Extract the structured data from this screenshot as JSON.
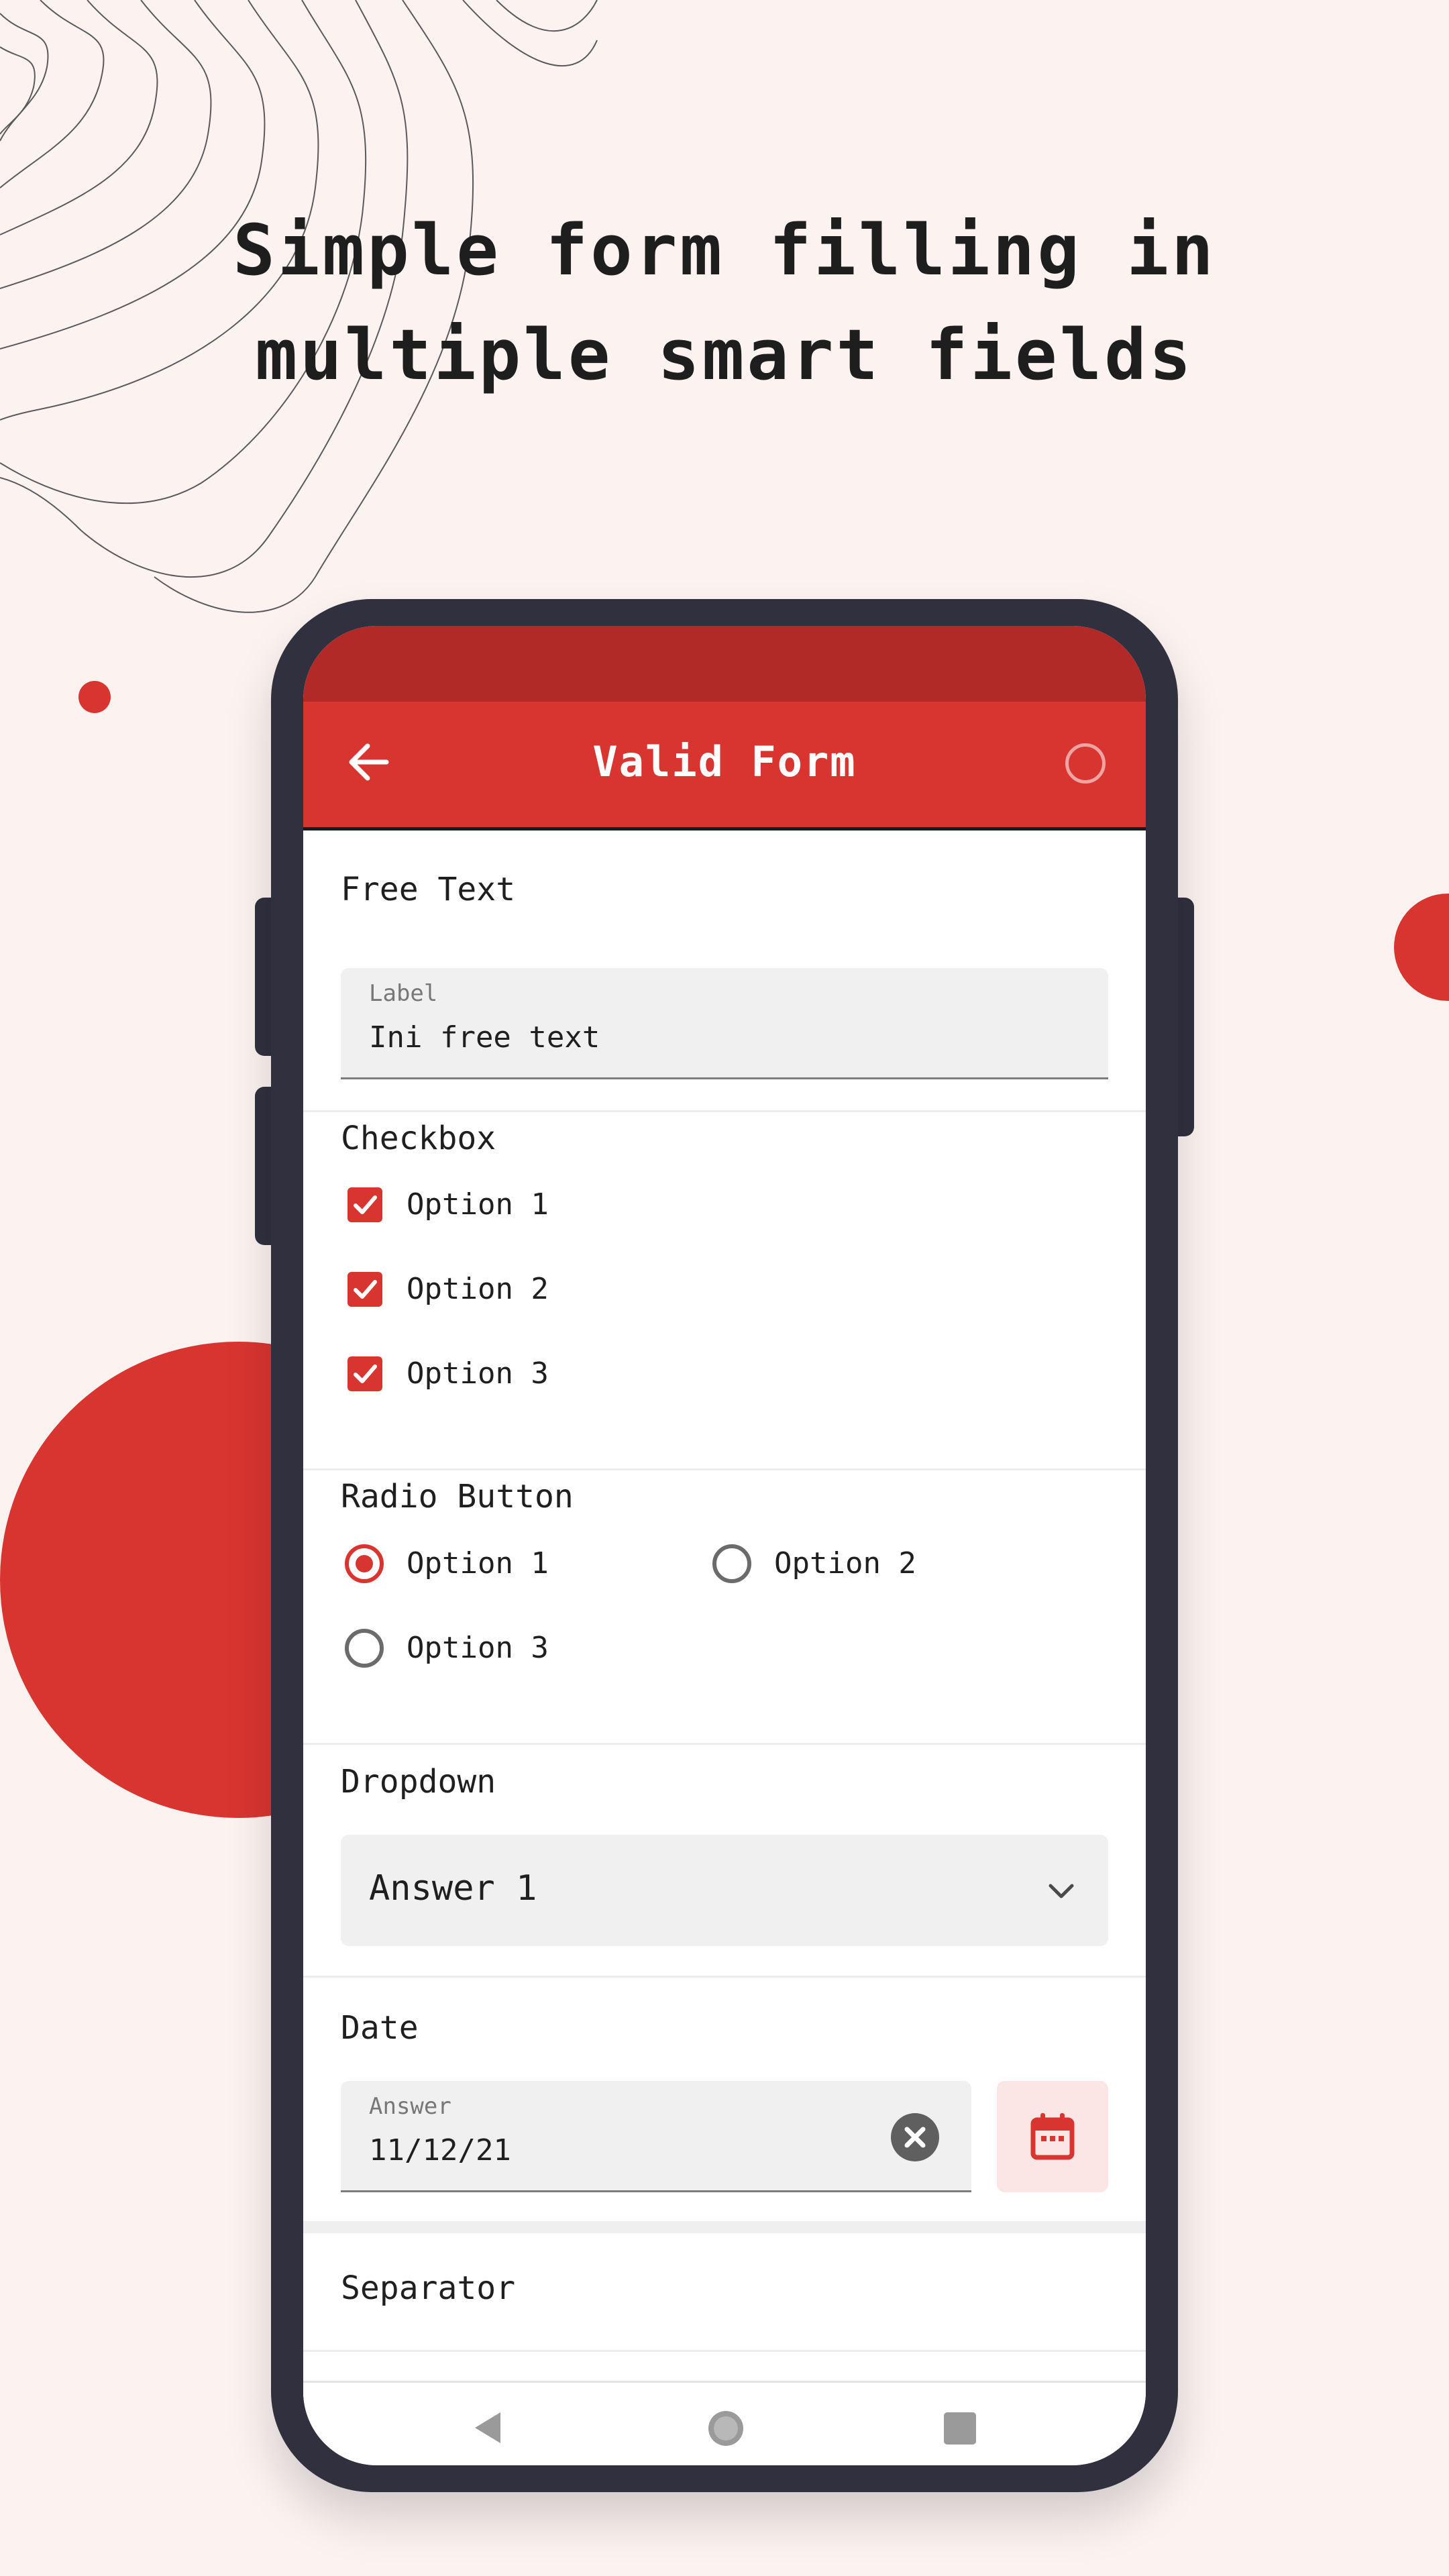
{
  "headline": {
    "line1": "Simple form filling in",
    "line2": "multiple smart fields"
  },
  "colors": {
    "accent": "#d93530",
    "status_bar": "#b12a28",
    "background": "#fcf3f1",
    "device": "#30303f"
  },
  "app_bar": {
    "title": "Valid Form",
    "back_icon": "arrow-left-icon",
    "action_icon": "circle-outline-icon"
  },
  "free_text": {
    "title": "Free Text",
    "label": "Label",
    "value": "Ini free text"
  },
  "checkbox": {
    "title": "Checkbox",
    "options": [
      {
        "label": "Option 1",
        "checked": true
      },
      {
        "label": "Option 2",
        "checked": true
      },
      {
        "label": "Option 3",
        "checked": true
      }
    ]
  },
  "radio": {
    "title": "Radio Button",
    "options": [
      {
        "label": "Option 1",
        "selected": true
      },
      {
        "label": "Option 2",
        "selected": false
      },
      {
        "label": "Option 3",
        "selected": false
      }
    ]
  },
  "dropdown": {
    "title": "Dropdown",
    "value": "Answer 1",
    "icon": "chevron-down-icon"
  },
  "date": {
    "title": "Date",
    "label": "Answer",
    "value": "11/12/21",
    "clear_icon": "clear-icon",
    "calendar_icon": "calendar-icon"
  },
  "separator": {
    "title": "Separator"
  },
  "navbar": {
    "icons": [
      "back-triangle-icon",
      "home-circle-icon",
      "recents-square-icon"
    ]
  }
}
